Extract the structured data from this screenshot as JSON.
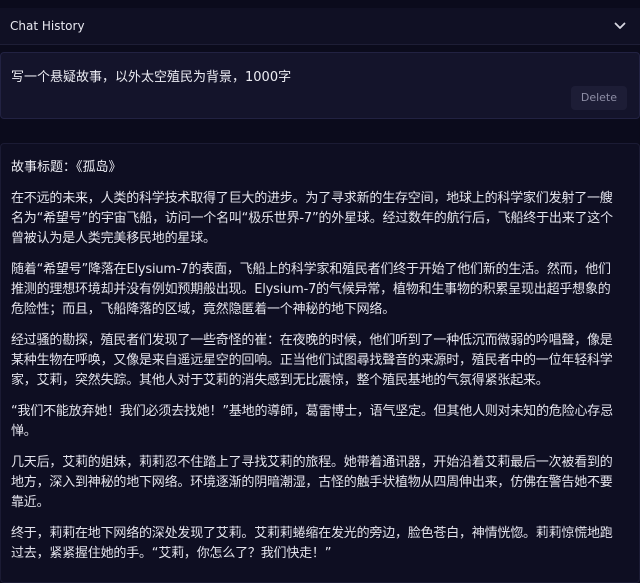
{
  "chat_history": {
    "label": "Chat History",
    "toggle_icon": "chevron-down-icon"
  },
  "prompt": {
    "text": "写一个悬疑故事，以外太空殖民为背景，1000字",
    "delete_label": "Delete"
  },
  "story": {
    "title": "故事标题：《孤岛》",
    "paragraphs": [
      "在不远的未来，人类的科学技术取得了巨大的进步。为了寻求新的生存空间，地球上的科学家们发射了一艘名为“希望号”的宇宙飞船，访问一个名叫“极乐世界-7”的外星球。经过数年的航行后，飞船终于出来了这个曾被认为是人类完美移民地的星球。",
      "随着“希望号”降落在Elysium-7的表面，飞船上的科学家和殖民者们终于开始了他们新的生活。然而，他们推测的理想环境却并没有例如预期般出现。Elysium-7的气候异常，植物和生事物的积累呈现出超乎想象的危险性；而且，飞船降落的区域，竟然隐匿着一个神秘的地下网络。",
      "经过骚的勘探，殖民者们发现了一些奇怪的崔：在夜晚的时候，他们听到了一种低沉而微弱的吟唱聲，像是某种生物在呼唤，又像是来自遥远星空的回响。正当他们试图尋找聲音的来源时，殖民者中的一位年轻科学家，艾莉，突然失踪。其他人对于艾莉的消失感到无比震惊，整个殖民基地的气氛得紧张起来。",
      "“我们不能放弃她！我们必须去找她！”基地的導師，葛雷博士，语气坚定。但其他人则对未知的危险心存忌惮。",
      "几天后，艾莉的姐妹，莉莉忍不住踏上了寻找艾莉的旅程。她带着通讯器，开始沿着艾莉最后一次被看到的地方，深入到神秘的地下网络。环境逐渐的阴暗潮湿，古怪的触手状植物从四周伸出来，仿佛在警告她不要靠近。",
      "终于，莉莉在地下网络的深处发现了艾莉。艾莉莉蜷缩在发光的旁边，脸色苍白，神情恍惚。莉莉惊慌地跑过去，紧紧握住她的手。“艾莉，你怎么了？我们快走！”"
    ]
  }
}
